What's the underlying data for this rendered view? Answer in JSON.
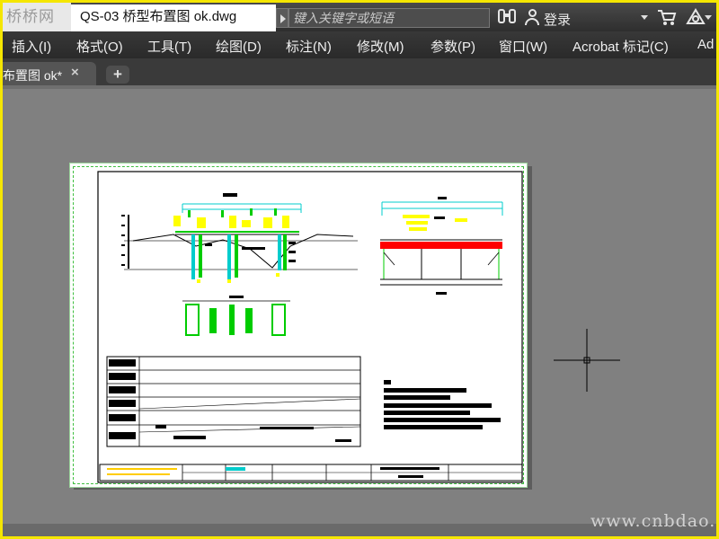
{
  "titlebar": {
    "logo_text": "桥桥网",
    "document_title": "QS-03 桥型布置图 ok.dwg",
    "search_placeholder": "键入关键字或短语",
    "login_label": "登录"
  },
  "menubar": {
    "items": [
      {
        "label": "插入(I)"
      },
      {
        "label": "格式(O)"
      },
      {
        "label": "工具(T)"
      },
      {
        "label": "绘图(D)"
      },
      {
        "label": "标注(N)"
      },
      {
        "label": "修改(M)"
      },
      {
        "label": "参数(P)"
      },
      {
        "label": "窗口(W)"
      },
      {
        "label": "Acrobat 标记(C)"
      },
      {
        "label": "Ad"
      }
    ]
  },
  "tabs": {
    "file_tab_label": "布置图 ok*",
    "close_glyph": "×",
    "new_tab_glyph": "+"
  },
  "watermark": "www.cnbdao.com",
  "colors": {
    "frame": "#f5e600",
    "workspace": "#808080",
    "sheet_border": "#3fbf3f",
    "drawing_yellow": "#ffff00",
    "drawing_red": "#ff0000",
    "drawing_cyan": "#00cccc"
  },
  "icons": [
    "binoculars-icon",
    "user-icon",
    "cart-icon",
    "a360-icon",
    "crosshair-cursor"
  ]
}
